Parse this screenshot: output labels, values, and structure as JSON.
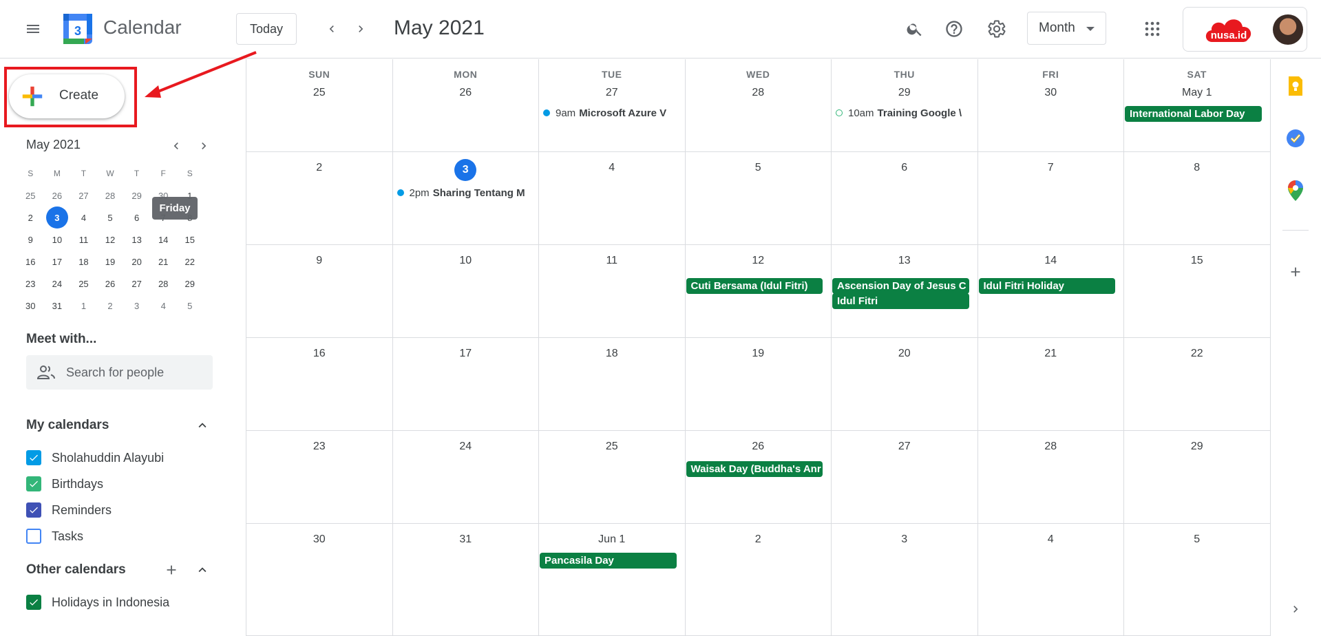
{
  "header": {
    "app_title": "Calendar",
    "logo_day": "3",
    "today_label": "Today",
    "current_period": "May 2021",
    "view_label": "Month",
    "org_badge": "nusa.id"
  },
  "icons": [
    "menu-icon",
    "calendar-logo-icon",
    "chevron-left-icon",
    "chevron-right-icon",
    "search-icon",
    "help-icon",
    "settings-icon",
    "apps-grid-icon",
    "people-icon",
    "chevron-up-icon",
    "plus-icon",
    "keep-icon",
    "tasks-icon",
    "maps-icon",
    "expand-icon"
  ],
  "sidebar": {
    "create_label": "Create",
    "mini_calendar": {
      "title": "May 2021",
      "dow": [
        "S",
        "M",
        "T",
        "W",
        "T",
        "F",
        "S"
      ],
      "weeks": [
        [
          "25",
          "26",
          "27",
          "28",
          "29",
          "30",
          "1"
        ],
        [
          "2",
          "3",
          "4",
          "5",
          "6",
          "7",
          "8"
        ],
        [
          "9",
          "10",
          "11",
          "12",
          "13",
          "14",
          "15"
        ],
        [
          "16",
          "17",
          "18",
          "19",
          "20",
          "21",
          "22"
        ],
        [
          "23",
          "24",
          "25",
          "26",
          "27",
          "28",
          "29"
        ],
        [
          "30",
          "31",
          "1",
          "2",
          "3",
          "4",
          "5"
        ]
      ],
      "today": "3",
      "tooltip": "Friday"
    },
    "meet_with_title": "Meet with...",
    "search_people_placeholder": "Search for people",
    "my_calendars_title": "My calendars",
    "my_calendars": [
      {
        "name": "Sholahuddin Alayubi",
        "color": "#039be5",
        "checked": true
      },
      {
        "name": "Birthdays",
        "color": "#33b679",
        "checked": true
      },
      {
        "name": "Reminders",
        "color": "#3f51b5",
        "checked": true
      },
      {
        "name": "Tasks",
        "color": "#4285f4",
        "checked": false
      }
    ],
    "other_calendars_title": "Other calendars",
    "other_calendars": [
      {
        "name": "Holidays in Indonesia",
        "color": "#0b8043",
        "checked": true
      }
    ]
  },
  "grid": {
    "dow": [
      "SUN",
      "MON",
      "TUE",
      "WED",
      "THU",
      "FRI",
      "SAT"
    ],
    "weeks": [
      [
        "25",
        "26",
        "27",
        "28",
        "29",
        "30",
        "May 1"
      ],
      [
        "2",
        "3",
        "4",
        "5",
        "6",
        "7",
        "8"
      ],
      [
        "9",
        "10",
        "11",
        "12",
        "13",
        "14",
        "15"
      ],
      [
        "16",
        "17",
        "18",
        "19",
        "20",
        "21",
        "22"
      ],
      [
        "23",
        "24",
        "25",
        "26",
        "27",
        "28",
        "29"
      ],
      [
        "30",
        "31",
        "Jun 1",
        "2",
        "3",
        "4",
        "5"
      ]
    ],
    "today": "3",
    "timed_events": [
      {
        "time": "9am",
        "title": "Microsoft Azure V",
        "dot": "#039be5"
      },
      {
        "time": "10am",
        "title": "Training Google \\",
        "dot": "#33b679"
      },
      {
        "time": "2pm",
        "title": "Sharing Tentang M",
        "dot": "#039be5"
      }
    ],
    "allday_events": [
      {
        "title": "International Labor Day"
      },
      {
        "title": "Cuti Bersama (Idul Fitri)"
      },
      {
        "title": "Ascension Day of Jesus C"
      },
      {
        "title": "Idul Fitri"
      },
      {
        "title": "Idul Fitri Holiday"
      },
      {
        "title": "Waisak Day (Buddha's Anr"
      },
      {
        "title": "Pancasila Day"
      }
    ],
    "event_color": "#0b8043"
  },
  "colors": {
    "accent": "#1a73e8",
    "highlight": "#e8191f"
  }
}
